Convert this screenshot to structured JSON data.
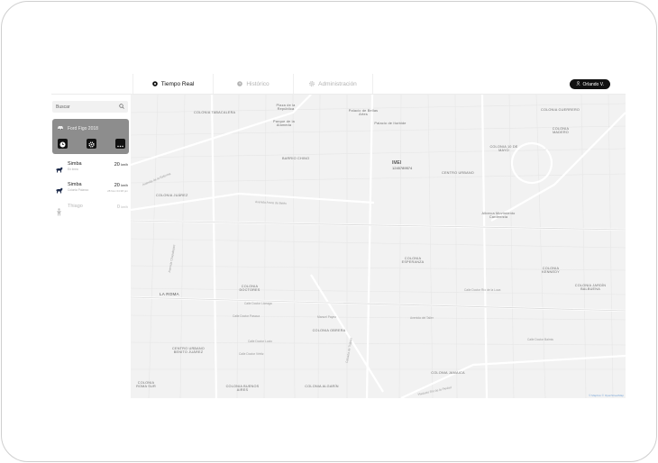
{
  "nav": {
    "tabs": [
      {
        "label": "Tiempo Real",
        "icon": "target-icon",
        "active": true
      },
      {
        "label": "Histórico",
        "icon": "history-icon",
        "active": false
      },
      {
        "label": "Administración",
        "icon": "gear-icon",
        "active": false
      }
    ],
    "user": "Orlando V."
  },
  "sidebar": {
    "search_placeholder": "Buscar",
    "selected_vehicle": "Ford Figo 2018",
    "vehicles": [
      {
        "name": "Simba",
        "sub": "En línea",
        "speed": "20",
        "unit": "km/h",
        "time": ""
      },
      {
        "name": "Simba",
        "sub": "Colonia Polanco",
        "speed": "20",
        "unit": "km/h",
        "time": "28 Nov 04:38 pm"
      },
      {
        "name": "Thiago",
        "sub": "",
        "speed": "0",
        "unit": "km/h",
        "time": ""
      }
    ]
  },
  "map": {
    "imei_label": "IMEI",
    "imei_value": "1245789574",
    "labels": [
      "COLONIA TABACALERA",
      "Plaza de la República",
      "Palacio de Bellas Artes",
      "Parque de la Alameda",
      "Palacio de Iturbide",
      "COLONIA GUERRERO",
      "COLONIA 10 DE MAYO",
      "COLONIA MADERO",
      "BARRIO CHINO",
      "CENTRO URBANO",
      "COLONIA JUÁREZ",
      "Alberca Movimiento Cardenista",
      "COLONIA ESPERANZA",
      "COLONIA KENNEDY",
      "COLONIA JARDÍN BALBUENA",
      "LA ROMA",
      "COLONIA DOCTORES",
      "CENTRO URBANO BENITO JUÁREZ",
      "COLONIA OBRERA",
      "COLONIA JAMAICA",
      "COLONIA ROMA SUR",
      "COLONIA BUENOS AIRES",
      "COLONIA ALGARÍN"
    ],
    "streets": [
      "Avenida de la Reforma",
      "Avenida Arcos de Belén",
      "Calle Doctor Pascua",
      "Calle Doctor Liceaga",
      "Calle Doctor Vértiz",
      "Manuel Payno",
      "Avenida del Taller",
      "Calle Doctor Lucio",
      "Calle Doctor Río de la Loza",
      "Calzada de Tlalpan",
      "Avenida Chapultepec",
      "Calle Doctor Balmis",
      "Viaducto Río de la Piedad"
    ],
    "attribution": "© Mapbox © OpenStreetMap"
  },
  "colors": {
    "accent": "#111111",
    "map_bg": "#f2f2f2",
    "card": "#8d8d8d"
  }
}
